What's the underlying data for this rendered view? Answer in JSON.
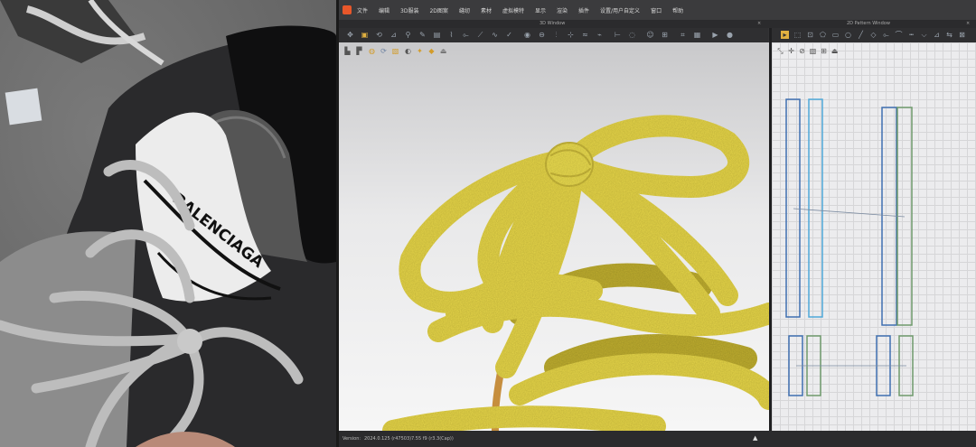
{
  "photo": {
    "brand_text": "BALENCIAGA"
  },
  "menubar": {
    "items": [
      "文件",
      "编辑",
      "3D服装",
      "2D图案",
      "缝纫",
      "素材",
      "虚拟模特",
      "显示",
      "渲染",
      "插件",
      "设置/用户自定义",
      "窗口",
      "帮助"
    ]
  },
  "tabs": {
    "window_3d": "3D Window",
    "window_2d": "2D Pattern Window",
    "close_glyph": "×"
  },
  "status": {
    "version_label": "Version:",
    "version_value": "2024.0.125 (r47503)",
    "mode_value": "7.55 f9 (r3.3(Cap))"
  },
  "colors": {
    "lace_yellow": "#e8da4e",
    "aglet": "#d9a95a",
    "pattern_blue": "#3f6fb0",
    "pattern_cyan": "#4fa8d8",
    "pattern_green": "#6e9a6c",
    "accent_orange": "#e8572a"
  },
  "icons": {
    "toolbar3d": [
      "select-icon",
      "move-icon",
      "rotate-icon",
      "fold-icon",
      "pin-icon",
      "brush-icon",
      "fabric-icon",
      "seam-icon",
      "sew-icon",
      "line-sew-icon",
      "free-sew-icon",
      "check-sew-icon",
      "button-icon",
      "buttonhole-icon",
      "zipper-icon",
      "tack-icon",
      "puckering-icon",
      "elastic-icon",
      "measure-icon",
      "circumference-icon",
      "avatar-icon",
      "arrange-icon",
      "grid-icon",
      "texture-icon",
      "simulate-icon",
      "record-icon"
    ],
    "toolbar2d": [
      "select-icon",
      "transform-icon",
      "edit-point-icon",
      "polygon-icon",
      "rectangle-icon",
      "circle-icon",
      "internal-line-icon",
      "dart-icon",
      "sew-icon",
      "trace-icon",
      "topstitch-icon",
      "notch-icon",
      "fold-icon",
      "symmetry-icon",
      "grade-icon",
      "measure-icon"
    ]
  }
}
